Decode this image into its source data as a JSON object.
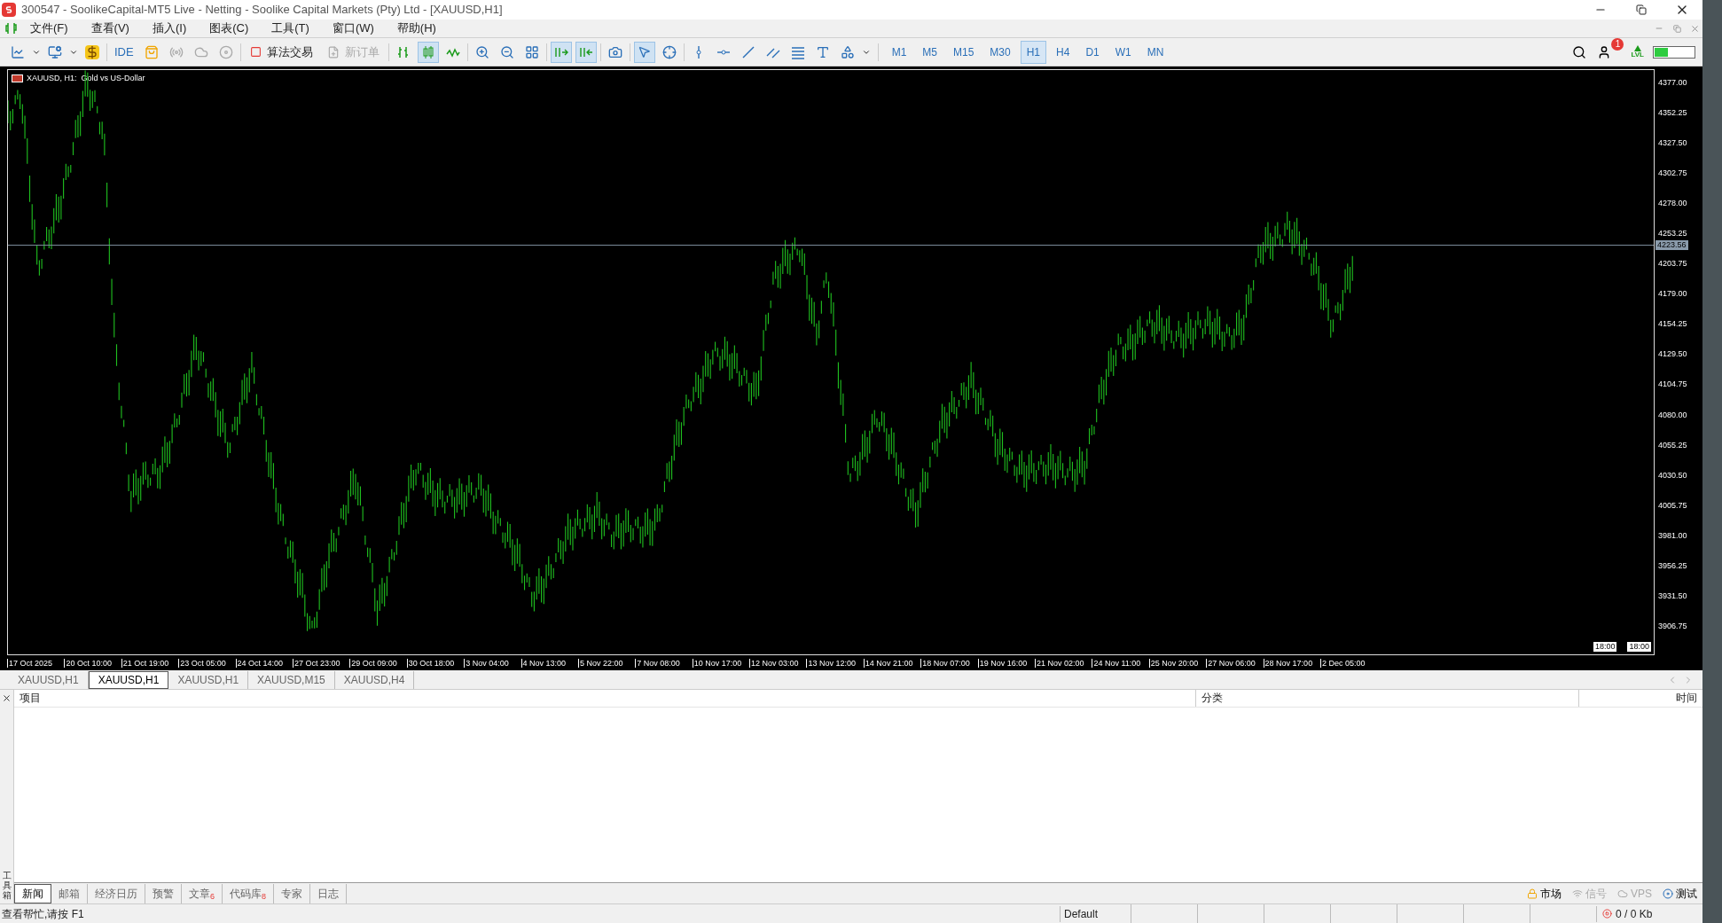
{
  "window": {
    "title": "300547 - SoolikeCapital-MT5 Live - Netting - Soolike Capital Markets (Pty) Ltd - [XAUUSD,H1]"
  },
  "menu": [
    "文件(F)",
    "查看(V)",
    "插入(I)",
    "图表(C)",
    "工具(T)",
    "窗口(W)",
    "帮助(H)"
  ],
  "toolbar": {
    "ide": "IDE",
    "algo_trading": {
      "label": "算法交易",
      "on": false
    },
    "new_order": {
      "label": "新订单",
      "disabled": true
    },
    "timeframes": [
      {
        "label": "M1",
        "selected": false
      },
      {
        "label": "M5",
        "selected": false
      },
      {
        "label": "M15",
        "selected": false
      },
      {
        "label": "M30",
        "selected": false
      },
      {
        "label": "H1",
        "selected": true
      },
      {
        "label": "H4",
        "selected": false
      },
      {
        "label": "D1",
        "selected": false
      },
      {
        "label": "W1",
        "selected": false
      },
      {
        "label": "MN",
        "selected": false
      }
    ],
    "notification_count": "1",
    "lvl": "LVL",
    "level": 0.35
  },
  "chart": {
    "title": "XAUUSD, H1:  Gold vs US-Dollar",
    "current_price": "4223.56",
    "price_ticks": [
      "4377.00",
      "4352.25",
      "4327.50",
      "4302.75",
      "4278.00",
      "4253.25",
      "4203.75",
      "4179.00",
      "4154.25",
      "4129.50",
      "4104.75",
      "4080.00",
      "4055.25",
      "4030.50",
      "4005.75",
      "3981.00",
      "3956.25",
      "3931.50",
      "3906.75"
    ],
    "time_ticks": [
      "17 Oct 2025",
      "20 Oct 10:00",
      "21 Oct 19:00",
      "23 Oct 05:00",
      "24 Oct 14:00",
      "27 Oct 23:00",
      "29 Oct 09:00",
      "30 Oct 18:00",
      "3 Nov 04:00",
      "4 Nov 13:00",
      "5 Nov 22:00",
      "7 Nov 08:00",
      "10 Nov 17:00",
      "12 Nov 03:00",
      "13 Nov 12:00",
      "14 Nov 21:00",
      "18 Nov 07:00",
      "19 Nov 16:00",
      "21 Nov 02:00",
      "24 Nov 11:00",
      "25 Nov 20:00",
      "27 Nov 06:00",
      "28 Nov 17:00",
      "2 Dec 05:00"
    ],
    "period_markers": [
      "18:00",
      "18:00"
    ]
  },
  "chart_tabs": [
    {
      "label": "XAUUSD,H1",
      "selected": false
    },
    {
      "label": "XAUUSD,H1",
      "selected": true
    },
    {
      "label": "XAUUSD,H1",
      "selected": false
    },
    {
      "label": "XAUUSD,M15",
      "selected": false
    },
    {
      "label": "XAUUSD,H4",
      "selected": false
    }
  ],
  "toolbox": {
    "side_label": "工具箱",
    "columns": [
      "项目",
      "分类",
      "时间"
    ],
    "tabs": [
      {
        "label": "新闻",
        "selected": true
      },
      {
        "label": "邮箱",
        "selected": false
      },
      {
        "label": "经济日历",
        "selected": false
      },
      {
        "label": "预警",
        "selected": false
      },
      {
        "label": "文章",
        "badge": "6",
        "selected": false
      },
      {
        "label": "代码库",
        "badge": "8",
        "selected": false
      },
      {
        "label": "专家",
        "selected": false
      },
      {
        "label": "日志",
        "selected": false
      }
    ],
    "right_items": [
      {
        "label": "市场",
        "disabled": false
      },
      {
        "label": "信号",
        "disabled": true
      },
      {
        "label": "VPS",
        "disabled": true
      },
      {
        "label": "测试",
        "disabled": false
      }
    ]
  },
  "status_bar": {
    "help": "查看帮忙,请按 F1",
    "profile": "Default",
    "traffic": "0 / 0 Kb"
  }
}
